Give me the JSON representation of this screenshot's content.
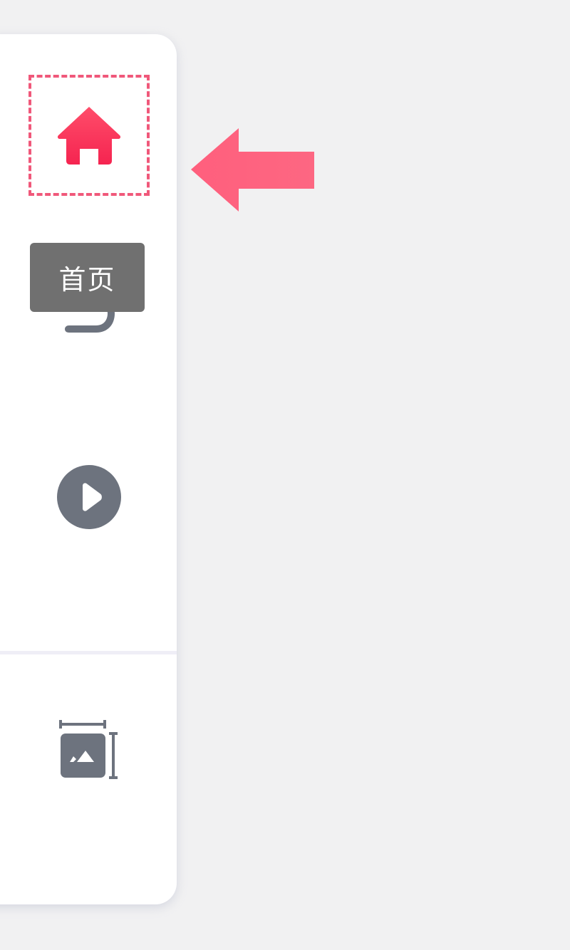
{
  "sidebar": {
    "items": [
      {
        "id": "home",
        "icon": "home-icon",
        "active": true
      },
      {
        "id": "back",
        "icon": "undo-arrow-icon"
      },
      {
        "id": "play",
        "icon": "play-circle-icon"
      },
      {
        "id": "fit",
        "icon": "image-fit-size-icon"
      }
    ],
    "tooltip": {
      "text": "首页"
    }
  },
  "colors": {
    "accent": "#ff3d62",
    "highlight_border": "#f0587a",
    "pointer_arrow": "#fd6481",
    "icon_gray": "#6d737e",
    "tooltip_bg": "#707070",
    "background": "#f1f1f2",
    "panel": "#ffffff"
  }
}
